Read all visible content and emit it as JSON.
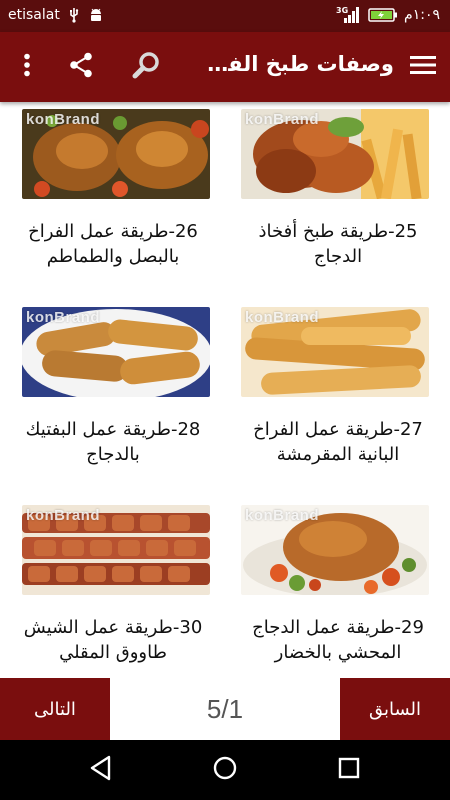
{
  "status_bar": {
    "carrier": "etisalat",
    "time": "١:٠٩م",
    "network": "3G",
    "icons": [
      "usb-icon",
      "android-icon",
      "signal-icon",
      "battery-charging-icon"
    ]
  },
  "app_bar": {
    "title": "وصفات طبخ الفراخ والدجاج",
    "icons": [
      "menu-icon",
      "search-icon",
      "share-icon",
      "more-vert-icon"
    ]
  },
  "items": [
    {
      "caption": "25-طريقة طبخ أفخاذ الدجاج",
      "watermark": "konBrand"
    },
    {
      "caption": "26-طريقة عمل الفراخ بالبصل والطماطم",
      "watermark": "konBrand"
    },
    {
      "caption": "27-طريقة عمل الفراخ البانية المقرمشة",
      "watermark": "konBrand"
    },
    {
      "caption": "28-طريقة عمل البفتيك بالدجاج",
      "watermark": "konBrand"
    },
    {
      "caption": "29-طريقة عمل الدجاج المحشي بالخضار",
      "watermark": "konBrand"
    },
    {
      "caption": "30-طريقة عمل الشيش طاووق المقلي",
      "watermark": "konBrand"
    }
  ],
  "pager": {
    "prev_label": "السابق",
    "next_label": "التالى",
    "counter": "5/1"
  },
  "nav_bar": {
    "icons": [
      "back-icon",
      "home-icon",
      "recents-icon"
    ]
  },
  "colors": {
    "status_bar": "#5a0d0d",
    "app_bar": "#7a0e0e",
    "pager_buttons": "#7a0e0e",
    "nav_bar": "#000000"
  }
}
